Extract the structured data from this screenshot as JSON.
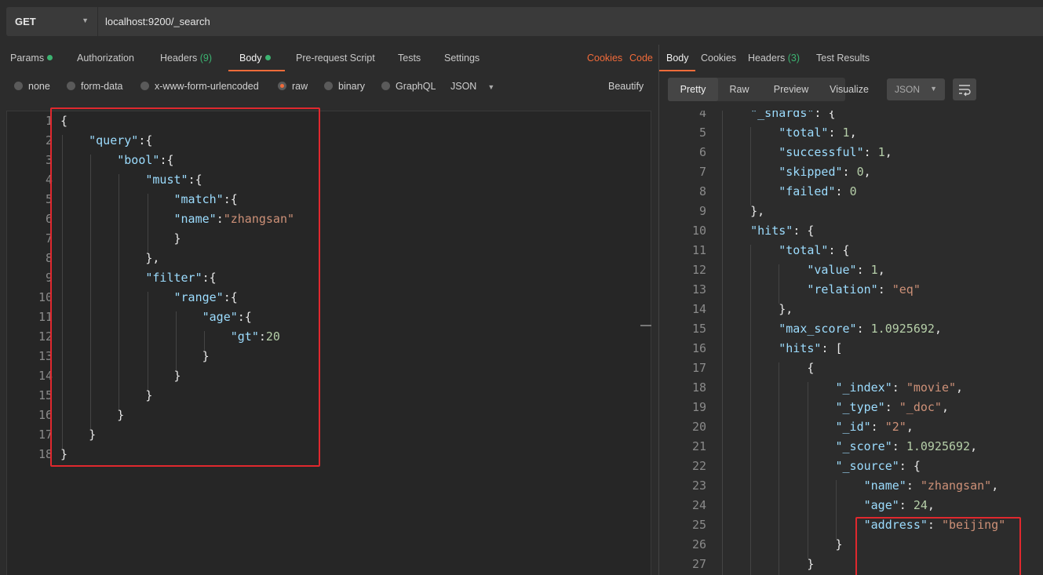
{
  "request": {
    "method": "GET",
    "url": "localhost:9200/_search"
  },
  "request_tabs": [
    {
      "label": "Params",
      "dot": true
    },
    {
      "label": "Authorization"
    },
    {
      "label": "Headers",
      "count": "(9)"
    },
    {
      "label": "Body",
      "dot": true,
      "active": true
    },
    {
      "label": "Pre-request Script"
    },
    {
      "label": "Tests"
    },
    {
      "label": "Settings"
    }
  ],
  "request_links": {
    "cookies": "Cookies",
    "code": "Code"
  },
  "body_types": [
    "none",
    "form-data",
    "x-www-form-urlencoded",
    "raw",
    "binary",
    "GraphQL"
  ],
  "body_selected": "raw",
  "body_format": "JSON",
  "beautify_label": "Beautify",
  "request_body": [
    "{",
    "    \"query\":{",
    "        \"bool\":{",
    "            \"must\":{",
    "                \"match\":{",
    "                \"name\":\"zhangsan\"",
    "                }",
    "            },",
    "            \"filter\":{",
    "                \"range\":{",
    "                    \"age\":{",
    "                        \"gt\":20",
    "                    }",
    "                }",
    "            }",
    "        }",
    "    }",
    "}"
  ],
  "response_tabs": [
    {
      "label": "Body",
      "active": true
    },
    {
      "label": "Cookies"
    },
    {
      "label": "Headers",
      "count": "(3)"
    },
    {
      "label": "Test Results"
    }
  ],
  "view_modes": [
    "Pretty",
    "Raw",
    "Preview",
    "Visualize"
  ],
  "view_active": "Pretty",
  "response_format": "JSON",
  "response_first_line": 4,
  "response_body": [
    "    \"_shards\": {",
    "        \"total\": 1,",
    "        \"successful\": 1,",
    "        \"skipped\": 0,",
    "        \"failed\": 0",
    "    },",
    "    \"hits\": {",
    "        \"total\": {",
    "            \"value\": 1,",
    "            \"relation\": \"eq\"",
    "        },",
    "        \"max_score\": 1.0925692,",
    "        \"hits\": [",
    "            {",
    "                \"_index\": \"movie\",",
    "                \"_type\": \"_doc\",",
    "                \"_id\": \"2\",",
    "                \"_score\": 1.0925692,",
    "                \"_source\": {",
    "                    \"name\": \"zhangsan\",",
    "                    \"age\": 24,",
    "                    \"address\": \"beijing\"",
    "                }",
    "            }"
  ],
  "colors": {
    "accent": "#f26b3a",
    "key": "#9cdcfe",
    "string": "#ce9178",
    "number": "#b5cea8",
    "highlight": "#e0282e",
    "status_dot": "#3cb371"
  }
}
